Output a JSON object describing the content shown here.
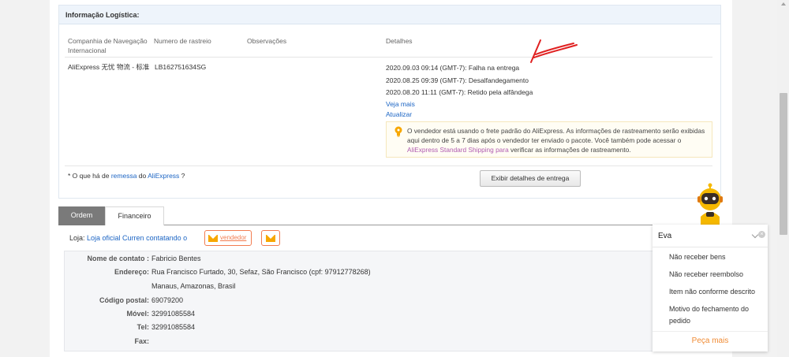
{
  "logistics": {
    "title": "Informação Logística:",
    "headers": {
      "company": "Companhia de Navegação Internacional",
      "tracking": "Numero de rastreio",
      "notes": "Observações",
      "details": "Detalhes"
    },
    "company": "AliExpress 无忧 物流 - 标准",
    "tracking_number": "LB162751634SG",
    "events": [
      "2020.09.03 09:14 (GMT-7): Falha na entrega",
      "2020.08.25 09:39 (GMT-7): Desalfandegamento",
      "2020.08.20 11:11 (GMT-7): Retido pela alfândega"
    ],
    "see_more": "Veja mais",
    "update": "Atualizar",
    "notice": {
      "part1": "O vendedor está usando o frete padrão do AliExpress. As informações de rastreamento serão exibidas aqui dentro de 5 a 7 dias após o vendedor ter enviado o pacote. Você também pode acessar o ",
      "link": "AliExpress Standard Shipping para",
      "part2": " verificar as informações de rastreamento."
    },
    "remessa": {
      "prefix": "* O que há de ",
      "link1": "remessa",
      "mid": " do ",
      "link2": "AliExpress",
      "suffix": " ?"
    },
    "delivery_button": "Exibir detalhes de entrega"
  },
  "tabs": {
    "order": "Ordem",
    "finance": "Financeiro"
  },
  "store": {
    "prefix": "Loja: ",
    "link": "Loja oficial Curren contatando o",
    "vendor_button": "vendedor"
  },
  "address": {
    "contact_label": "Nome de contato :",
    "contact": "Fabricio Bentes",
    "address_label": "Endereço:",
    "address1": "Rua Francisco Furtado, 30, Sefaz, São Francisco (cpf: 97912778268)",
    "address2": "Manaus, Amazonas, Brasil",
    "zip_label": "Código postal:",
    "zip": "69079200",
    "mobile_label": "Móvel:",
    "mobile": "32991085584",
    "tel_label": "Tel:",
    "tel": "32991085584",
    "fax_label": "Fax:",
    "fax": ""
  },
  "chat": {
    "title": "Eva",
    "options": [
      "Não receber bens",
      "Não receber reembolso",
      "Item não conforme descrito",
      "Motivo do fechamento do pedido"
    ],
    "more": "Peça mais"
  },
  "colors": {
    "link": "#1c65c4",
    "accent": "#f27c50",
    "more": "#f08c36"
  }
}
